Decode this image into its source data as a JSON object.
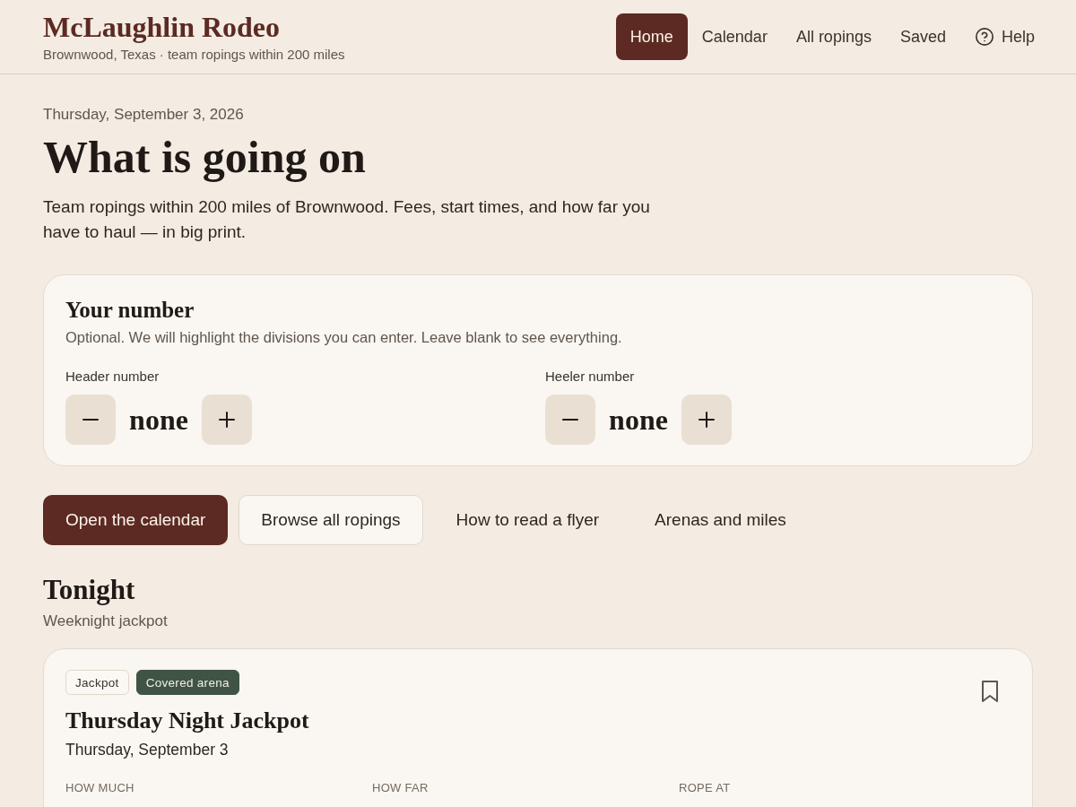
{
  "site": {
    "title": "McLaughlin Rodeo",
    "subtitle": "Brownwood, Texas · team ropings within 200 miles"
  },
  "nav": [
    {
      "label": "Home",
      "kind": "link",
      "selected": true
    },
    {
      "label": "Calendar",
      "kind": "link",
      "selected": false
    },
    {
      "label": "All ropings",
      "kind": "link",
      "selected": false
    },
    {
      "label": "Saved",
      "kind": "link",
      "selected": false
    },
    {
      "label": "Help",
      "kind": "help",
      "selected": false
    }
  ],
  "page": {
    "date": "Thursday, September 3, 2026",
    "title": "What is going on",
    "intro": "Team ropings within 200 miles of Brownwood. Fees, start times, and how far you have to haul — in big print."
  },
  "number_card": {
    "title": "Your number",
    "description": "Optional. We will highlight the divisions you can enter. Leave blank to see everything.",
    "fields": [
      {
        "label": "Header number",
        "value": "none"
      },
      {
        "label": "Heeler number",
        "value": "none"
      }
    ]
  },
  "actions": [
    {
      "label": "Open the calendar",
      "kind": "primary"
    },
    {
      "label": "Browse all ropings",
      "kind": "secondary"
    },
    {
      "label": "How to read a flyer",
      "kind": "link"
    },
    {
      "label": "Arenas and miles",
      "kind": "link"
    }
  ],
  "tonight": {
    "title": "Tonight",
    "subtitle": "Weeknight jackpot",
    "events": [
      {
        "tags": [
          {
            "label": "Jackpot",
            "kind": "outline"
          },
          {
            "label": "Covered arena",
            "kind": "filled"
          }
        ],
        "saved": false,
        "title": "Thursday Night Jackpot",
        "date": "Thursday, September 3",
        "stats": [
          {
            "label": "HOW MUCH"
          },
          {
            "label": "HOW FAR"
          },
          {
            "label": "ROPE AT"
          }
        ]
      }
    ]
  }
}
